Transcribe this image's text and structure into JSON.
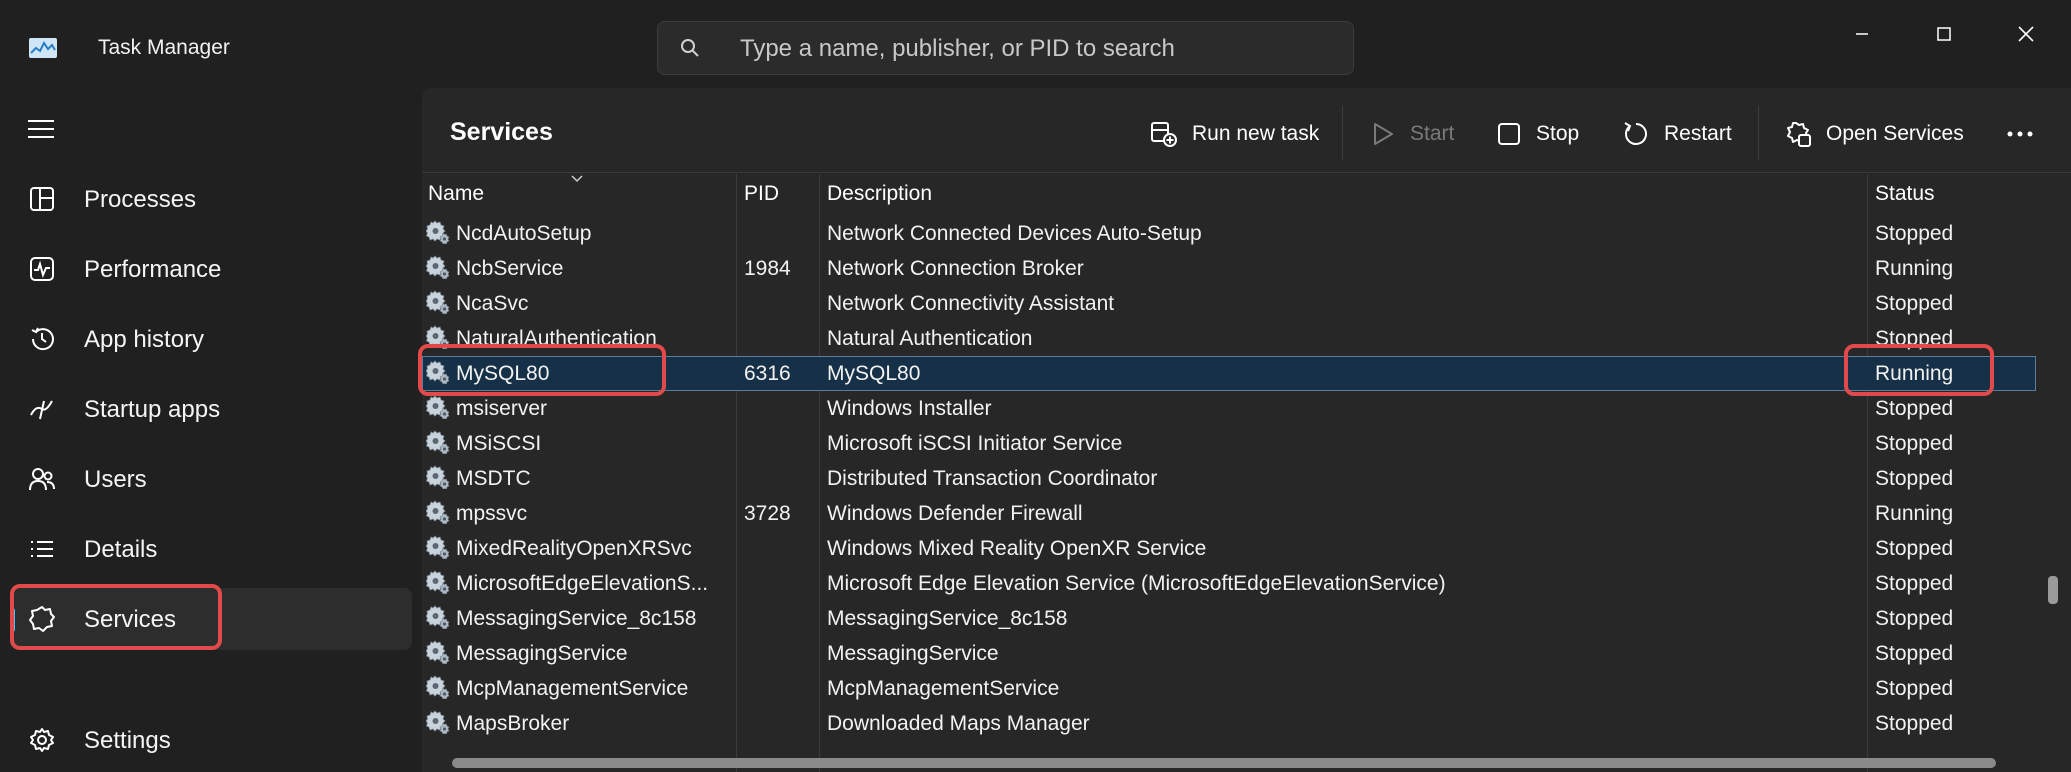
{
  "app": {
    "title": "Task Manager"
  },
  "search": {
    "placeholder": "Type a name, publisher, or PID to search"
  },
  "sidebar": {
    "items": [
      {
        "label": "Processes",
        "icon": "processes-icon"
      },
      {
        "label": "Performance",
        "icon": "performance-icon"
      },
      {
        "label": "App history",
        "icon": "history-icon"
      },
      {
        "label": "Startup apps",
        "icon": "startup-icon"
      },
      {
        "label": "Users",
        "icon": "users-icon"
      },
      {
        "label": "Details",
        "icon": "details-icon"
      },
      {
        "label": "Services",
        "icon": "services-icon",
        "active": true
      }
    ],
    "settings_label": "Settings"
  },
  "page": {
    "title": "Services"
  },
  "toolbar": {
    "run_new_task": "Run new task",
    "start": "Start",
    "stop": "Stop",
    "restart": "Restart",
    "open_services": "Open Services"
  },
  "table": {
    "headers": {
      "name": "Name",
      "pid": "PID",
      "description": "Description",
      "status": "Status"
    },
    "rows": [
      {
        "name": "NcdAutoSetup",
        "pid": "",
        "description": "Network Connected Devices Auto-Setup",
        "status": "Stopped"
      },
      {
        "name": "NcbService",
        "pid": "1984",
        "description": "Network Connection Broker",
        "status": "Running"
      },
      {
        "name": "NcaSvc",
        "pid": "",
        "description": "Network Connectivity Assistant",
        "status": "Stopped"
      },
      {
        "name": "NaturalAuthentication",
        "pid": "",
        "description": "Natural Authentication",
        "status": "Stopped"
      },
      {
        "name": "MySQL80",
        "pid": "6316",
        "description": "MySQL80",
        "status": "Running",
        "selected": true
      },
      {
        "name": "msiserver",
        "pid": "",
        "description": "Windows Installer",
        "status": "Stopped"
      },
      {
        "name": "MSiSCSI",
        "pid": "",
        "description": "Microsoft iSCSI Initiator Service",
        "status": "Stopped"
      },
      {
        "name": "MSDTC",
        "pid": "",
        "description": "Distributed Transaction Coordinator",
        "status": "Stopped"
      },
      {
        "name": "mpssvc",
        "pid": "3728",
        "description": "Windows Defender Firewall",
        "status": "Running"
      },
      {
        "name": "MixedRealityOpenXRSvc",
        "pid": "",
        "description": "Windows Mixed Reality OpenXR Service",
        "status": "Stopped"
      },
      {
        "name": "MicrosoftEdgeElevationS...",
        "pid": "",
        "description": "Microsoft Edge Elevation Service (MicrosoftEdgeElevationService)",
        "status": "Stopped"
      },
      {
        "name": "MessagingService_8c158",
        "pid": "",
        "description": "MessagingService_8c158",
        "status": "Stopped"
      },
      {
        "name": "MessagingService",
        "pid": "",
        "description": "MessagingService",
        "status": "Stopped"
      },
      {
        "name": "McpManagementService",
        "pid": "",
        "description": "McpManagementService",
        "status": "Stopped"
      },
      {
        "name": "MapsBroker",
        "pid": "",
        "description": "Downloaded Maps Manager",
        "status": "Stopped"
      }
    ]
  },
  "colors": {
    "accent": "#4cc2ff",
    "highlight": "#e04a4a",
    "selected_row": "#163047"
  }
}
